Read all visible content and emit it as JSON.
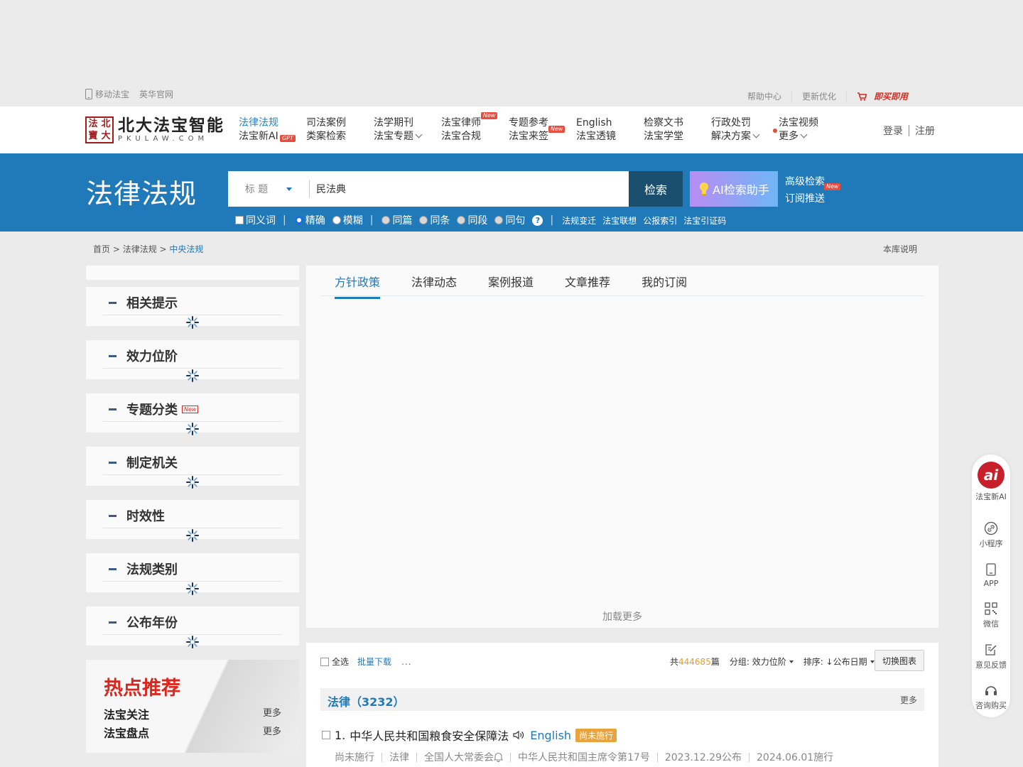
{
  "utilbar": {
    "mobile": "移动法宝",
    "yinghua": "英华官网",
    "help": "帮助中心",
    "update": "更新优化",
    "buy": "即买即用"
  },
  "logo": {
    "seal": [
      "法",
      "北",
      "寶",
      "大"
    ],
    "cn": "北大法宝智能",
    "en": "PKULAW.COM"
  },
  "nav": [
    {
      "top": "法律法规",
      "bottom": "法宝新AI",
      "tag": "GPT"
    },
    {
      "top": "司法案例",
      "bottom": "类案检索"
    },
    {
      "top": "法学期刊",
      "bottom": "法宝专题"
    },
    {
      "top": "法宝律师",
      "bottom": "法宝合规",
      "tag": "New"
    },
    {
      "top": "专题参考",
      "bottom": "法宝来签",
      "tag": "New"
    },
    {
      "top": "English",
      "bottom": "法宝透镜"
    },
    {
      "top": "检察文书",
      "bottom": "法宝学堂"
    },
    {
      "top": "行政处罚",
      "bottom": "解决方案"
    },
    {
      "top": "法宝视频",
      "bottom": "更多"
    }
  ],
  "auth": {
    "login": "登录",
    "register": "注册"
  },
  "search": {
    "section_title": "法律法规",
    "field": "标 题",
    "value": "民法典",
    "button": "检索",
    "ai_button": "AI检索助手",
    "advanced": "高级检索",
    "subscribe": "订阅推送",
    "new_tag": "New",
    "synonym": "同义词",
    "exact": "精确",
    "fuzzy": "模糊",
    "scopes": [
      "同篇",
      "同条",
      "同段",
      "同句"
    ],
    "help": "?",
    "links": [
      "法规变迁",
      "法宝联想",
      "公报索引",
      "法宝引证码"
    ]
  },
  "breadcrumb": {
    "home": "首页",
    "laws": "法律法规",
    "current": "中央法规",
    "sep": " > "
  },
  "library_note": "本库说明",
  "facets": [
    {
      "label": "相关提示"
    },
    {
      "label": "效力位阶"
    },
    {
      "label": "专题分类",
      "tag": "New"
    },
    {
      "label": "制定机关"
    },
    {
      "label": "时效性"
    },
    {
      "label": "法规类别"
    },
    {
      "label": "公布年份"
    }
  ],
  "hot": {
    "title": "热点推荐",
    "rows": [
      {
        "label": "法宝关注",
        "more": "更多"
      },
      {
        "label": "法宝盘点",
        "more": "更多"
      }
    ]
  },
  "tabs": [
    "方针政策",
    "法律动态",
    "案例报道",
    "文章推荐",
    "我的订阅"
  ],
  "load_more": "加载更多",
  "results": {
    "select_all": "全选",
    "batch_download": "批量下载",
    "more_dots": "...",
    "total_prefix": "共",
    "total": "444685",
    "total_suffix": "篇",
    "group_label": "分组: 效力位阶",
    "sort_label": "排序: ↓公布日期",
    "switch": "切换图表",
    "group_title": "法律（3232）",
    "group_more": "更多",
    "item": {
      "index": "1.",
      "title": "中华人民共和国粮食安全保障法",
      "english": "English",
      "status": "尚未施行",
      "meta": [
        "尚未施行",
        "法律",
        "全国人大常委会",
        "中华人民共和国主席令第17号",
        "2023.12.29公布",
        "2024.06.01施行"
      ]
    }
  },
  "floatbar": [
    "法宝新AI",
    "小程序",
    "APP",
    "微信",
    "意见反馈",
    "咨询购买"
  ],
  "colors": {
    "brand_blue": "#2079b9",
    "accent_red": "#d9281f",
    "status_orange": "#e8a33c"
  }
}
